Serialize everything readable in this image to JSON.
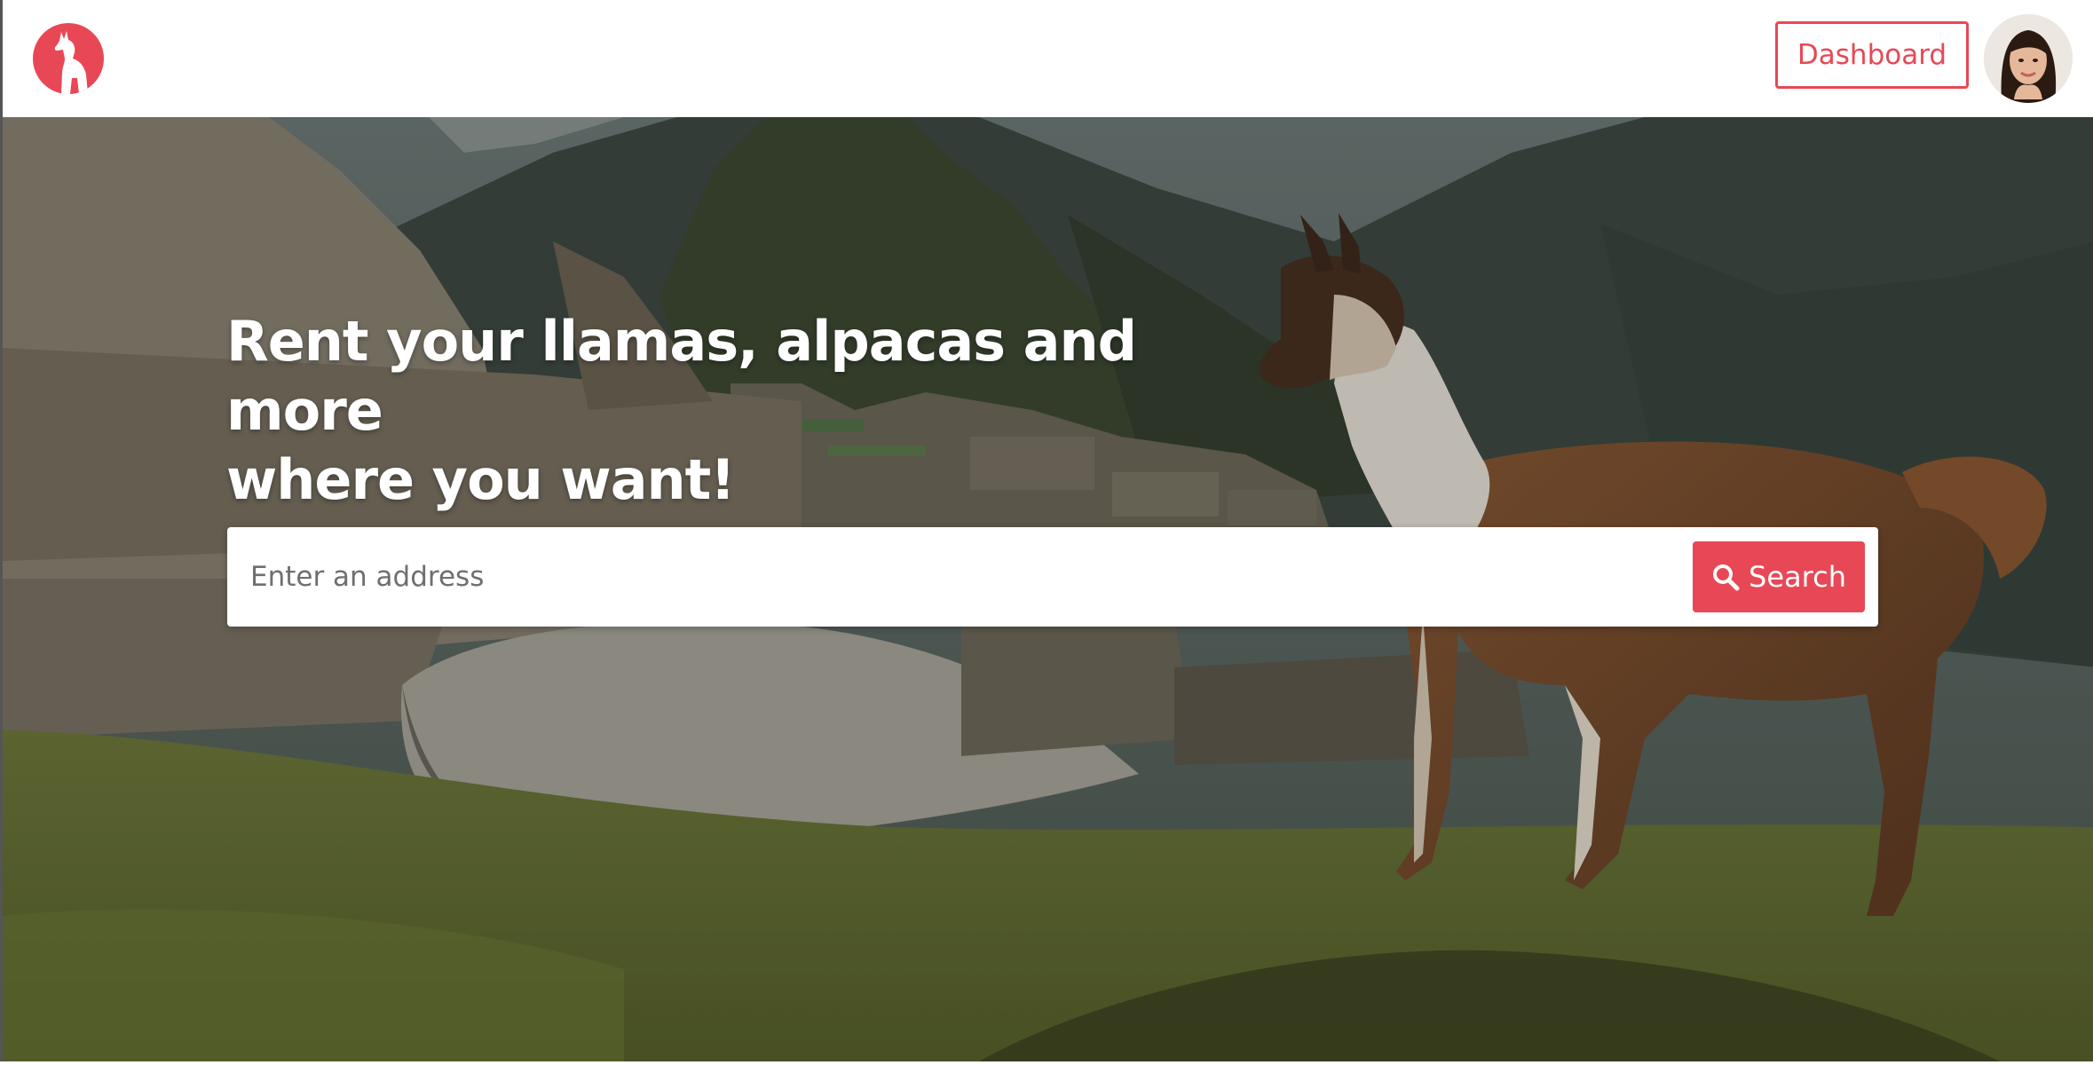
{
  "navbar": {
    "logo_icon": "llama-logo-icon",
    "dashboard_label": "Dashboard",
    "avatar_icon": "user-avatar"
  },
  "hero": {
    "title_line1": "Rent your llamas, alpacas and more",
    "title_line2": "where you want!",
    "background_icon": "machu-picchu-llama-photo"
  },
  "search": {
    "placeholder": "Enter an address",
    "value": "",
    "button_label": "Search",
    "button_icon": "search-icon"
  },
  "colors": {
    "accent": "#e84855",
    "text_on_hero": "#ffffff"
  }
}
